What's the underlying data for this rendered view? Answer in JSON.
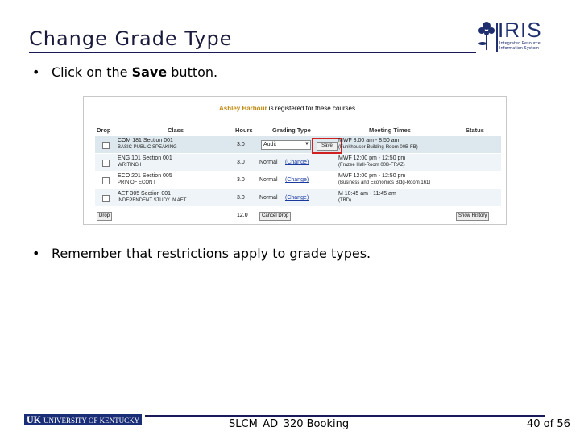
{
  "slide": {
    "title": "Change Grade Type",
    "bullet1_pre": "Click on the ",
    "bullet1_bold": "Save",
    "bullet1_post": " button.",
    "bullet2": "Remember that restrictions apply to grade types.",
    "bullet_symbol": "•"
  },
  "logo": {
    "word": "IRIS",
    "tagline": "Integrated Resource Information System"
  },
  "screenshot": {
    "student_name": "Ashley Harbour",
    "registered_text": " is registered for these courses.",
    "columns": [
      "Drop",
      "Class",
      "Hours",
      "Grading Type",
      "Meeting Times",
      "Status"
    ],
    "rows": [
      {
        "class": "COM 181 Section 001",
        "sub": "BASIC PUBLIC SPEAKING",
        "hours": "3.0",
        "grading": "Audit",
        "times": "MWF 8:00 am - 8:50 am",
        "loc": "(Funkhouser Building-Room 00B-FB)"
      },
      {
        "class": "ENG 101 Section 001",
        "sub": "WRITING I",
        "hours": "3.0",
        "grading": "Normal",
        "times": "MWF 12:00 pm - 12:50 pm",
        "loc": "(Frazee Hall-Room 00B-FRAZ)"
      },
      {
        "class": "ECO 201 Section 005",
        "sub": "PRIN OF ECON I",
        "hours": "3.0",
        "grading": "Normal",
        "times": "MWF 12:00 pm - 12:50 pm",
        "loc": "(Business and Economics Bldg-Room 161)"
      },
      {
        "class": "AET 305 Section 001",
        "sub": "INDEPENDENT STUDY IN AET",
        "hours": "3.0",
        "grading": "Normal",
        "times": "M 10:45 am - 11:45 am",
        "loc": "(TBD)"
      }
    ],
    "change_label": "(Change)",
    "save_label": "Save",
    "total_hours": "12.0",
    "drop_button": "Drop",
    "cancel_button": "Cancel Drop",
    "history_button": "Show History"
  },
  "footer": {
    "uk_letters": "UK",
    "uk_name": "UNIVERSITY OF KENTUCKY",
    "course": "SLCM_AD_320 Booking",
    "page": "40 of 56"
  },
  "colors": {
    "title_rule": "#1a1a5a",
    "uk_blue": "#1a2e78",
    "highlight": "#d02020",
    "name_gold": "#c08a10"
  }
}
